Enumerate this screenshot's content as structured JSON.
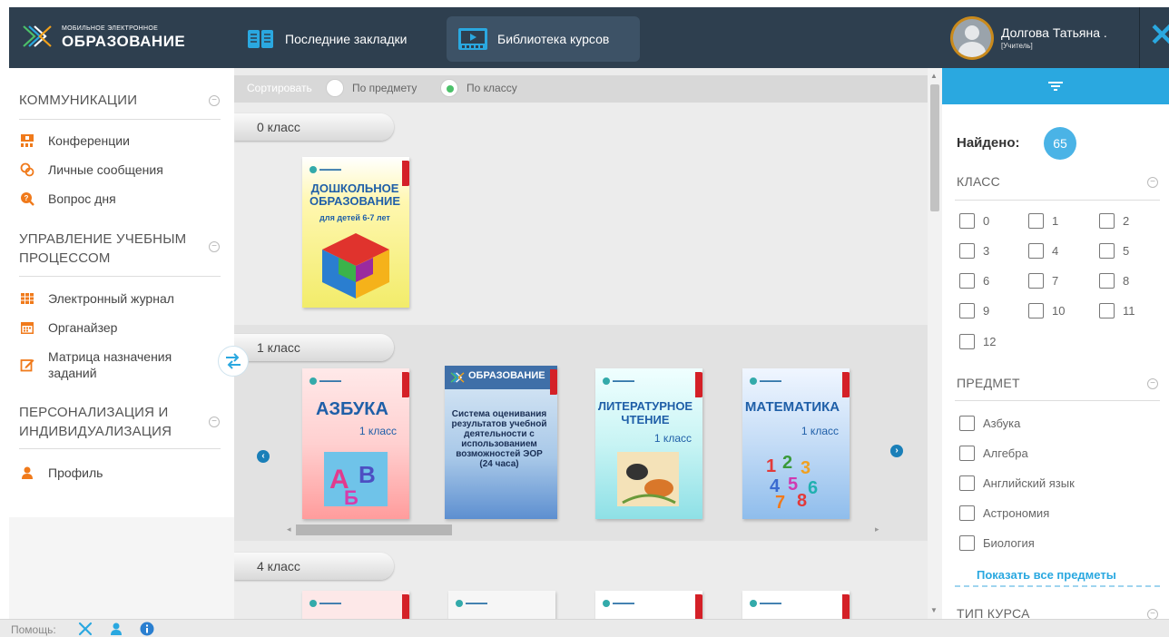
{
  "header": {
    "logo_small": "МОБИЛЬНОЕ ЭЛЕКТРОННОЕ",
    "logo_big": "ОБРАЗОВАНИЕ",
    "nav": [
      {
        "label": "Последние закладки",
        "icon": "book-open-icon",
        "active": false
      },
      {
        "label": "Библиотека курсов",
        "icon": "video-library-icon",
        "active": true
      }
    ],
    "user_name": "Долгова Татьяна .",
    "user_role": "[Учитель]",
    "close_icon": "close-icon",
    "accent": "#2aa8e0"
  },
  "sidebar": {
    "sections": [
      {
        "title": "КОММУНИКАЦИИ",
        "items": [
          "Конференции",
          "Личные сообщения",
          "Вопрос дня"
        ]
      },
      {
        "title": "УПРАВЛЕНИЕ УЧЕБНЫМ ПРОЦЕССОМ",
        "items": [
          "Электронный журнал",
          "Органайзер",
          "Матрица назначения заданий"
        ]
      },
      {
        "title": "ПЕРСОНАЛИЗАЦИЯ И ИНДИВИДУАЛИЗАЦИЯ",
        "items": [
          "Профиль"
        ]
      }
    ]
  },
  "main": {
    "sort_label": "Сортировать",
    "sort_options": [
      {
        "label": "По предмету",
        "selected": false
      },
      {
        "label": "По классу",
        "selected": true
      }
    ],
    "groups": [
      {
        "label": "0 класс",
        "books": [
          {
            "title": "ДОШКОЛЬНОЕ ОБРАЗОВАНИЕ",
            "subtitle": "для детей 6-7 лет"
          }
        ]
      },
      {
        "label": "1 класс",
        "books": [
          {
            "title": "АЗБУКА",
            "subtitle": "1 класс"
          },
          {
            "title": "ОБРАЗОВАНИЕ",
            "subtitle": "Система оценивания результатов учебной деятельности с использованием возможностей ЭОР (24 часа)"
          },
          {
            "title": "ЛИТЕРАТУРНОЕ ЧТЕНИЕ",
            "subtitle": "1 класс"
          },
          {
            "title": "МАТЕМАТИКА",
            "subtitle": "1 класс"
          }
        ]
      },
      {
        "label": "4 класс",
        "books": []
      }
    ]
  },
  "filter": {
    "found_label": "Найдено:",
    "found_count": "65",
    "class_title": "КЛАСС",
    "classes": [
      "0",
      "1",
      "2",
      "3",
      "4",
      "5",
      "6",
      "7",
      "8",
      "9",
      "10",
      "11",
      "12"
    ],
    "subject_title": "ПРЕДМЕТ",
    "subjects": [
      "Азбука",
      "Алгебра",
      "Английский язык",
      "Астрономия",
      "Биология"
    ],
    "show_all": "Показать все предметы",
    "course_type_title": "ТИП КУРСА"
  },
  "footer": {
    "help_label": "Помощь:"
  }
}
